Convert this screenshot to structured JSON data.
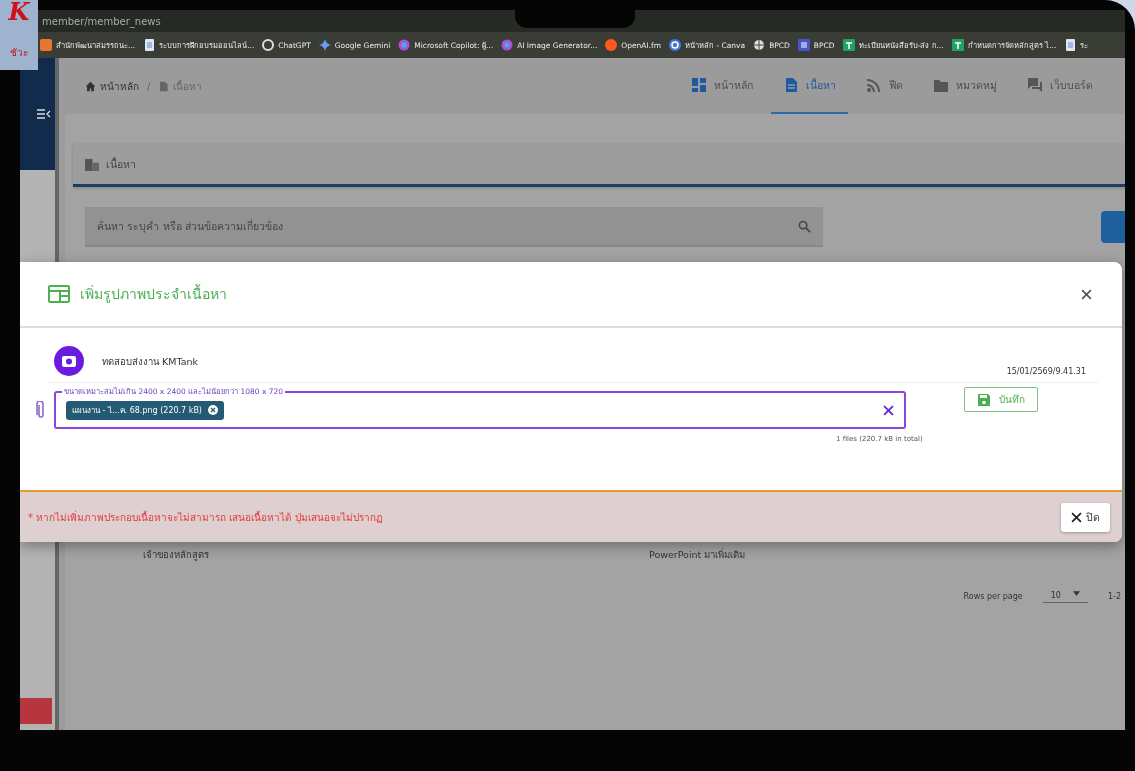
{
  "logo": {
    "letter": "K",
    "caption": "ชัวะ"
  },
  "browser": {
    "url": "member/member_news",
    "bookmarks": [
      {
        "label": "สำนักพัฒนาสมรรถนะ...",
        "kind": "image"
      },
      {
        "label": "ระบบการฝึกอบรมออนไลน์...",
        "kind": "doc"
      },
      {
        "label": "ChatGPT",
        "kind": "chatgpt"
      },
      {
        "label": "Google Gemini",
        "kind": "gemini"
      },
      {
        "label": "Microsoft Copilot: ผู้...",
        "kind": "copilot"
      },
      {
        "label": "AI Image Generator...",
        "kind": "copilot"
      },
      {
        "label": "OpenAI.fm",
        "kind": "dot"
      },
      {
        "label": "หน้าหลัก - Canva",
        "kind": "canva"
      },
      {
        "label": "BPCD",
        "kind": "globe"
      },
      {
        "label": "BPCD",
        "kind": "form"
      },
      {
        "label": "ทะเบียนหนังสือรับ-ส่ง ก...",
        "kind": "sheet"
      },
      {
        "label": "กำหนดการจัดหลักสูตร ไ...",
        "kind": "sheet"
      },
      {
        "label": "ระ",
        "kind": "doc"
      }
    ]
  },
  "breadcrumb": [
    "หน้าหลัก",
    "เนื้อหา"
  ],
  "breadcrumb_separator": "/",
  "nav_tabs": [
    {
      "label": "หน้าหลัก",
      "kind": "dashboard",
      "selected": false
    },
    {
      "label": "เนื้อหา",
      "kind": "document",
      "selected": true
    },
    {
      "label": "ฟีด",
      "kind": "rss",
      "selected": false
    },
    {
      "label": "หมวดหมู่",
      "kind": "folder",
      "selected": false
    },
    {
      "label": "เว็บบอร์ด",
      "kind": "forum",
      "selected": false
    }
  ],
  "section_title": "เนื้อหา",
  "search": {
    "placeholder": "ค้นหา ระบุคำ หรือ ส่วนข้อความเกี่ยวข้อง"
  },
  "table": {
    "cells": [
      "เจ้าของหลักสูตร",
      "PowerPoint มาเพิ่มเติม"
    ]
  },
  "pagination": {
    "label": "Rows per page",
    "value": "10",
    "range": "1-2"
  },
  "dialog": {
    "title": "เพิ่มรูปภาพประจำเนื้อหา",
    "author": "ทดสอบส่งงาน KMTank",
    "timestamp": "15/01/2569/9.41.31",
    "file_field": {
      "label": "ขนาดเหมาะสมไม่เกิน 2400 x 2400 และไม่น้อยกว่า 1080 x 720",
      "chips": [
        {
          "name": "แผนงาน - ไ...ค. 68.png (220.7 kB)"
        }
      ],
      "summary": "1 files (220.7 kB in total)"
    },
    "save_button": "บันทึก",
    "warning": "* หากไม่เพิ่มภาพประกอบเนื้อหาจะไม่สามารถ เสนอเนื้อหาได้ ปุ่มเสนอจะไม่ปรากฏ",
    "close_button": "ปิด"
  }
}
